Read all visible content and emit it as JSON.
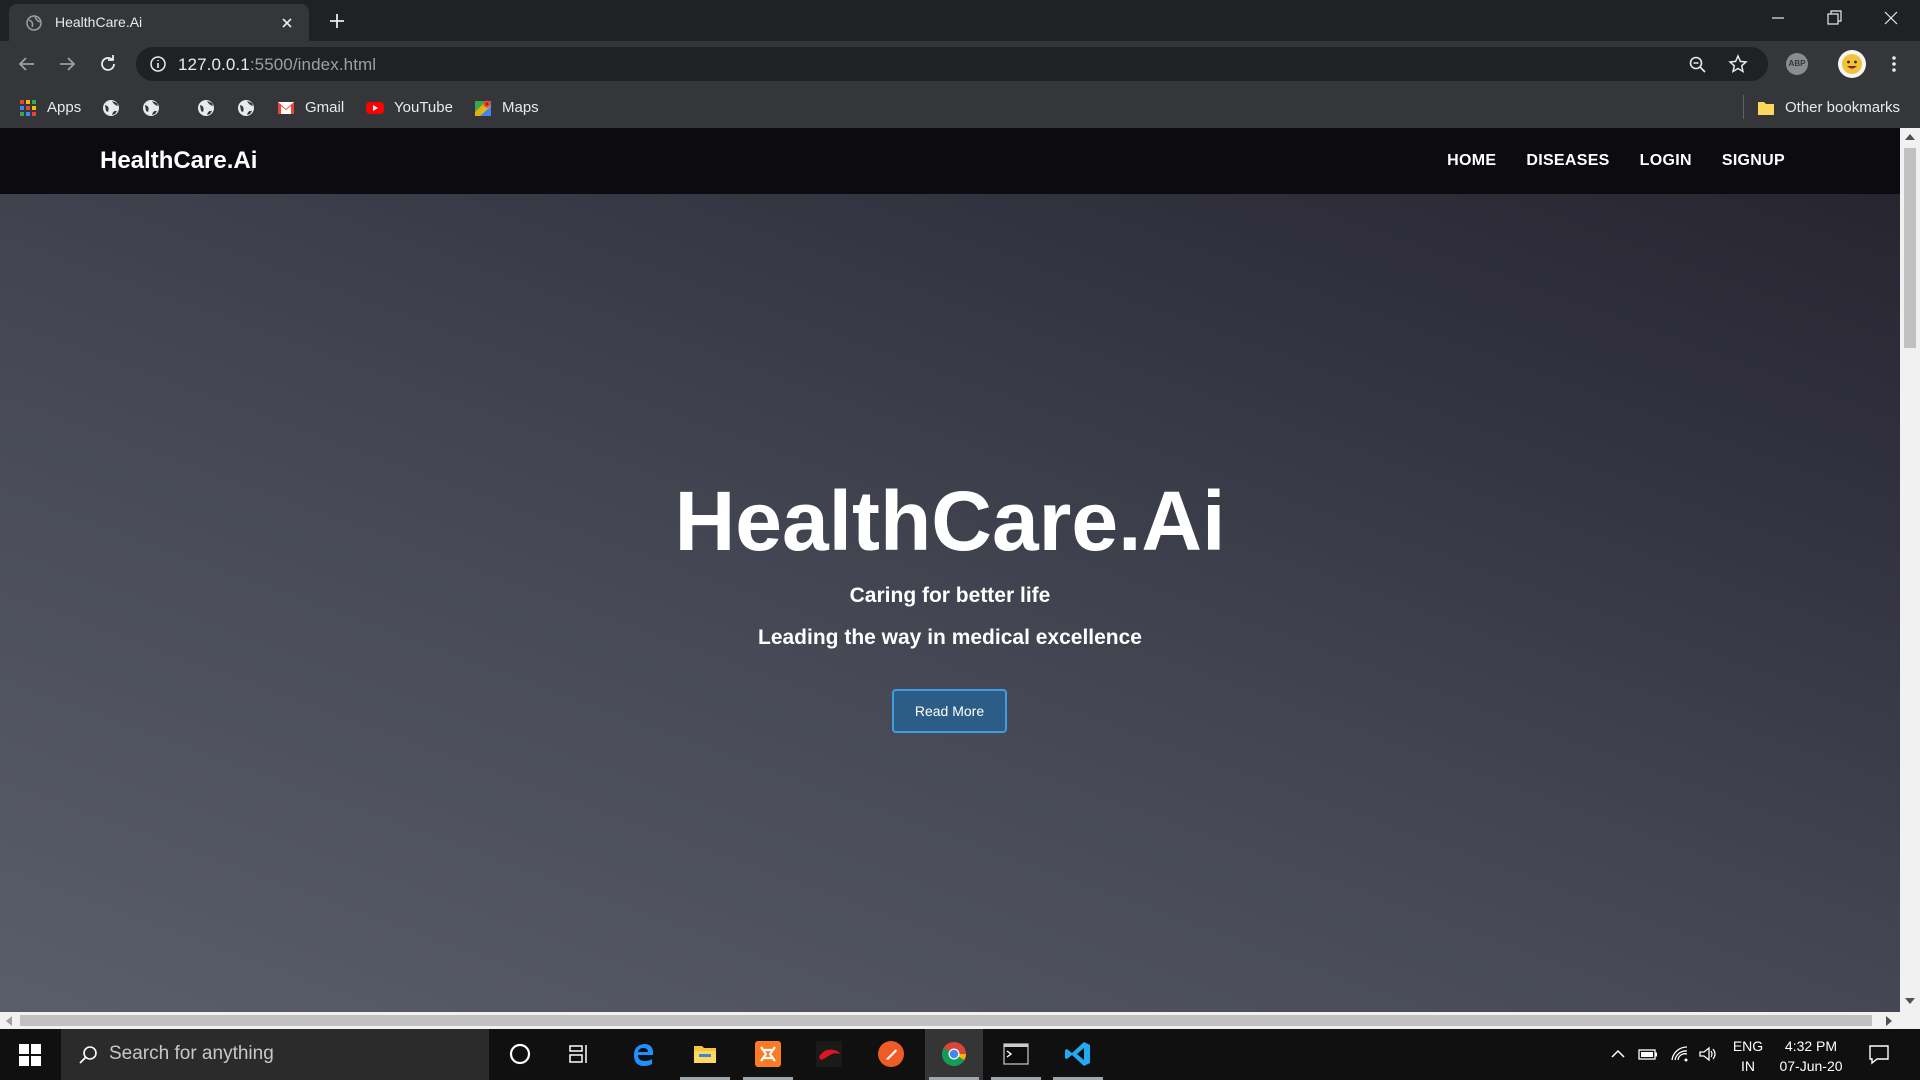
{
  "browser": {
    "tab_title": "HealthCare.Ai",
    "url_host": "127.0.0.1",
    "url_rest": ":5500/index.html",
    "bookmarks": [
      {
        "label": "Apps",
        "icon": "apps-grid-icon"
      },
      {
        "label": "",
        "icon": "globe-icon"
      },
      {
        "label": "",
        "icon": "globe-icon"
      },
      {
        "label": "",
        "icon": "globe-icon"
      },
      {
        "label": "",
        "icon": "globe-icon"
      },
      {
        "label": "Gmail",
        "icon": "gmail-icon"
      },
      {
        "label": "YouTube",
        "icon": "youtube-icon"
      },
      {
        "label": "Maps",
        "icon": "maps-icon"
      }
    ],
    "other_bookmarks": "Other bookmarks",
    "extension_badge": "ABP"
  },
  "site": {
    "brand": "HealthCare.Ai",
    "nav": [
      {
        "label": "HOME"
      },
      {
        "label": "DISEASES"
      },
      {
        "label": "LOGIN"
      },
      {
        "label": "SIGNUP"
      }
    ],
    "hero": {
      "title": "HealthCare.Ai",
      "subtitle1": "Caring for better life",
      "subtitle2": "Leading the way in medical excellence",
      "button": "Read More"
    }
  },
  "taskbar": {
    "search_placeholder": "Search for anything",
    "lang_line1": "ENG",
    "lang_line2": "IN",
    "time": "4:32 PM",
    "date": "07-Jun-20"
  },
  "colors": {
    "accent_button_border": "#3d9fe0",
    "accent_button_fill": "#2b5d86",
    "site_nav_bg": "#0b0b10"
  }
}
